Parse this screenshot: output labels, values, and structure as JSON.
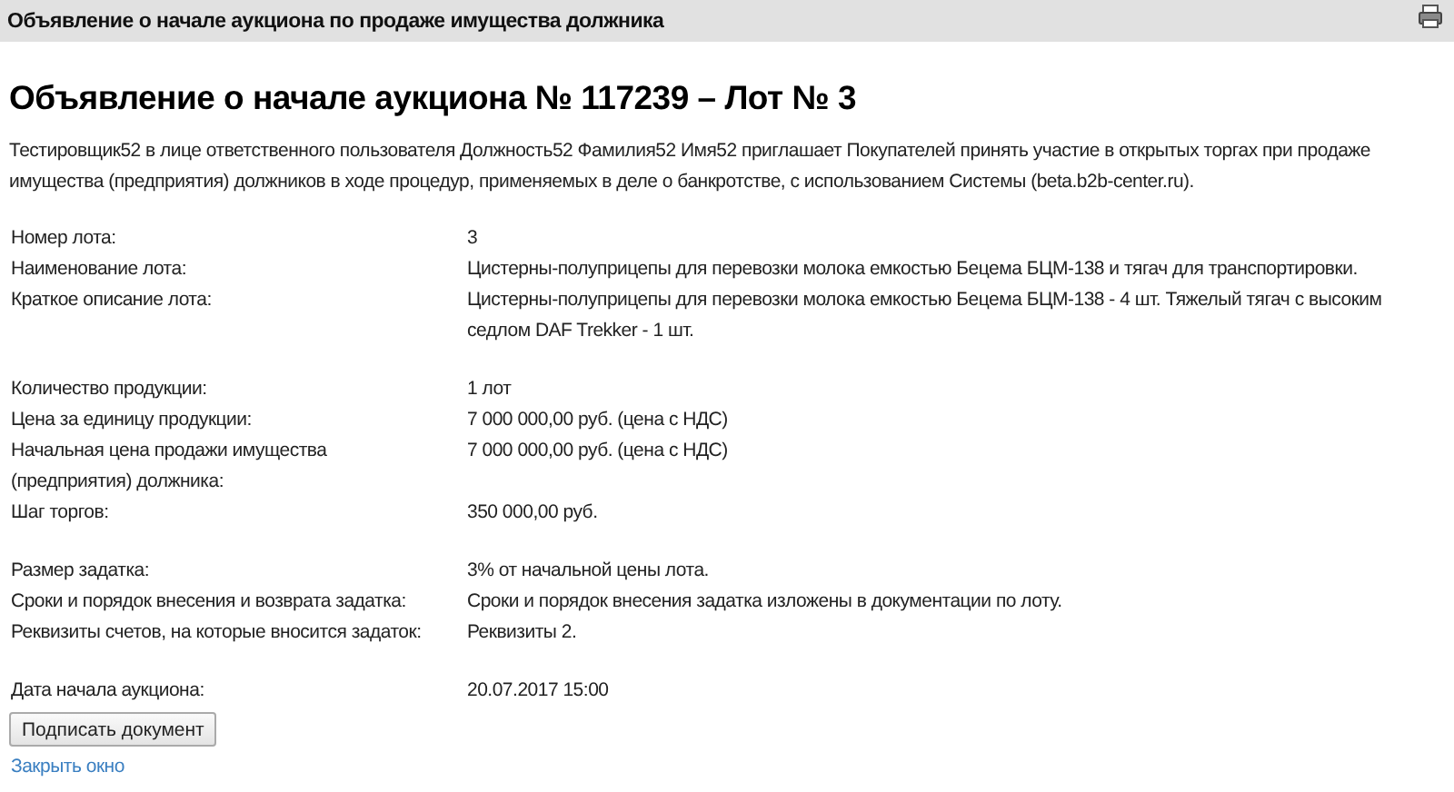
{
  "window": {
    "title": "Объявление о начале аукциона по продаже имущества должника"
  },
  "heading": "Объявление о начале аукциона № 117239 – Лот № 3",
  "intro": "Тестировщик52 в лице ответственного пользователя Должность52 Фамилия52 Имя52 приглашает Покупателей принять участие в открытых торгах при продаже имущества (предприятия) должников в ходе процедур, применяемых в деле о банкротстве, с использованием Системы (beta.b2b-center.ru).",
  "sections": [
    [
      {
        "label": "Номер лота:",
        "value": "3"
      },
      {
        "label": "Наименование лота:",
        "value": "Цистерны-полуприцепы для перевозки молока емкостью Бецема БЦМ-138 и тягач для транспортировки."
      },
      {
        "label": "Краткое описание лота:",
        "value": "Цистерны-полуприцепы для перевозки молока емкостью Бецема БЦМ-138 - 4 шт. Тяжелый тягач с высоким седлом DAF Trekker - 1 шт."
      }
    ],
    [
      {
        "label": "Количество продукции:",
        "value": "1 лот"
      },
      {
        "label": "Цена за единицу продукции:",
        "value": "7 000 000,00 руб. (цена с НДС)"
      },
      {
        "label": "Начальная цена продажи имущества (предприятия) должника:",
        "value": "7 000 000,00 руб. (цена с НДС)"
      },
      {
        "label": "Шаг торгов:",
        "value": "350 000,00 руб."
      }
    ],
    [
      {
        "label": "Размер задатка:",
        "value": "3% от начальной цены лота."
      },
      {
        "label": "Сроки и порядок внесения и возврата задатка:",
        "value": "Сроки и порядок внесения задатка изложены в документации по лоту."
      },
      {
        "label": "Реквизиты счетов, на которые вносится задаток:",
        "value": "Реквизиты 2."
      }
    ],
    [
      {
        "label": "Дата начала аукциона:",
        "value": "20.07.2017 15:00"
      }
    ]
  ],
  "sign_button": "Подписать документ",
  "close_link": "Закрыть окно"
}
